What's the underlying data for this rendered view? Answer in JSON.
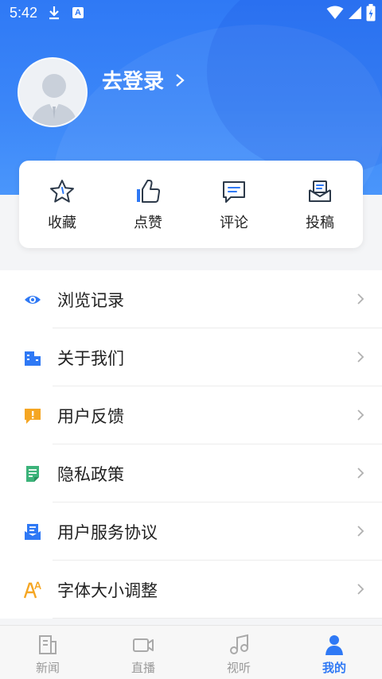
{
  "status_bar": {
    "time": "5:42",
    "a_badge": "A"
  },
  "profile": {
    "login_label": "去登录"
  },
  "actions": [
    {
      "label": "收藏",
      "icon": "star-icon"
    },
    {
      "label": "点赞",
      "icon": "thumbs-up-icon"
    },
    {
      "label": "评论",
      "icon": "comment-icon"
    },
    {
      "label": "投稿",
      "icon": "submit-icon"
    }
  ],
  "menu": [
    {
      "label": "浏览记录",
      "icon": "eye-icon"
    },
    {
      "label": "关于我们",
      "icon": "building-icon"
    },
    {
      "label": "用户反馈",
      "icon": "feedback-icon"
    },
    {
      "label": "隐私政策",
      "icon": "document-icon"
    },
    {
      "label": "用户服务协议",
      "icon": "agreement-icon"
    },
    {
      "label": "字体大小调整",
      "icon": "font-size-icon"
    }
  ],
  "bottom_nav": [
    {
      "label": "新闻",
      "icon": "news-icon"
    },
    {
      "label": "直播",
      "icon": "live-icon"
    },
    {
      "label": "视听",
      "icon": "music-icon"
    },
    {
      "label": "我的",
      "icon": "user-icon"
    }
  ],
  "colors": {
    "brand": "#2f79f5",
    "warning": "#f5a623",
    "green": "#3cb37a"
  }
}
